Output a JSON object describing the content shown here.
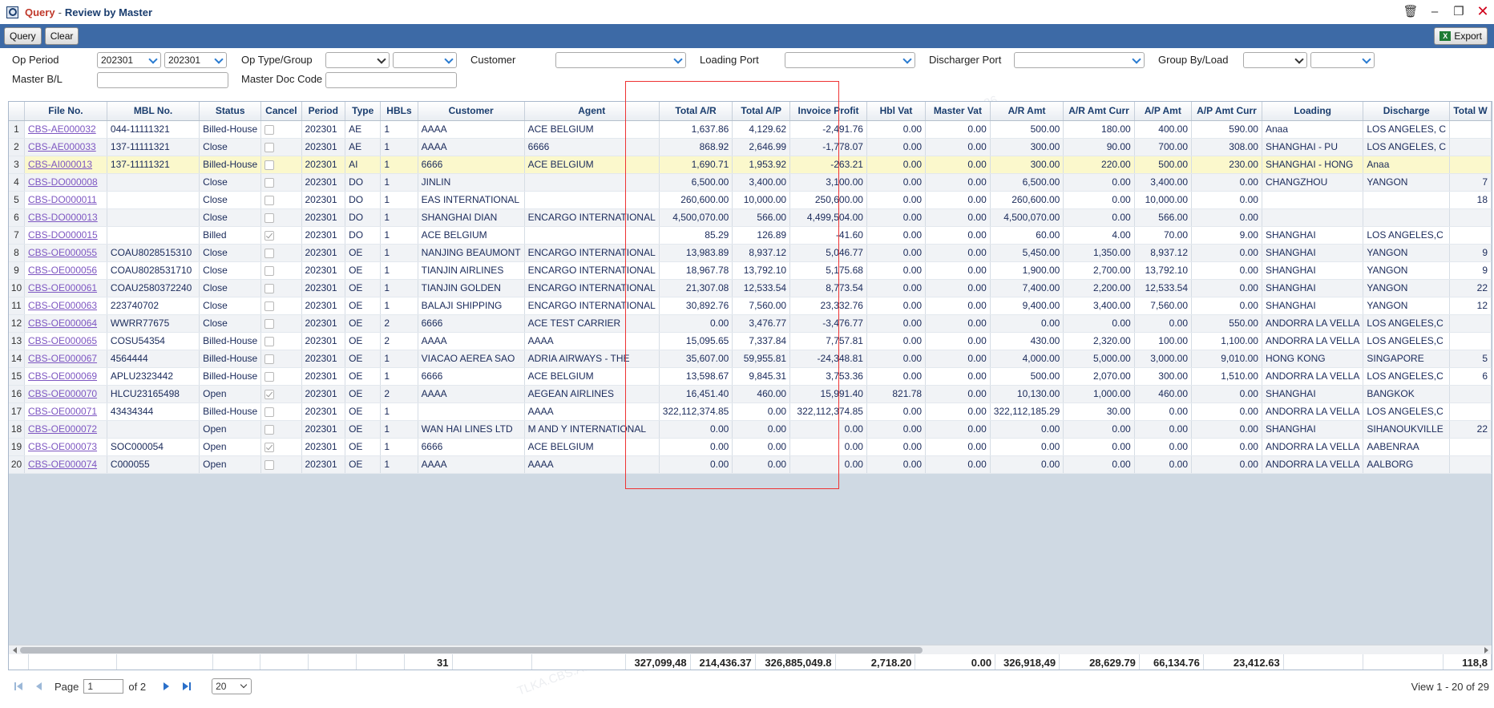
{
  "window": {
    "title_app": "Query",
    "title_sep": "-",
    "title_view": "Review by Master"
  },
  "toolbar": {
    "query_label": "Query",
    "clear_label": "Clear",
    "export_label": "Export"
  },
  "filters": {
    "op_period_label": "Op Period",
    "op_period_from": "202301",
    "op_period_to": "202301",
    "op_type_label": "Op Type/Group",
    "customer_label": "Customer",
    "loading_port_label": "Loading Port",
    "discharger_port_label": "Discharger Port",
    "group_by_label": "Group By/Load",
    "master_bl_label": "Master B/L",
    "master_doc_label": "Master Doc Code"
  },
  "columns": [
    "File No.",
    "MBL No.",
    "Status",
    "Cancel",
    "Period",
    "Type",
    "HBLs",
    "Customer",
    "Agent",
    "Total A/R",
    "Total A/P",
    "Invoice Profit",
    "Hbl Vat",
    "Master Vat",
    "A/R Amt",
    "A/R Amt Curr",
    "A/P Amt",
    "A/P Amt Curr",
    "Loading",
    "Discharge",
    "Total W"
  ],
  "rows": [
    [
      "1",
      "CBS-AE000032",
      "044-11111321",
      "Billed-House",
      "off",
      "202301",
      "AE",
      "1",
      "AAAA",
      "ACE BELGIUM",
      "1,637.86",
      "4,129.62",
      "-2,491.76",
      "0.00",
      "0.00",
      "500.00",
      "180.00",
      "400.00",
      "590.00",
      "Anaa",
      "LOS ANGELES, C",
      ""
    ],
    [
      "2",
      "CBS-AE000033",
      "137-11111321",
      "Close",
      "off",
      "202301",
      "AE",
      "1",
      "AAAA",
      "6666",
      "868.92",
      "2,646.99",
      "-1,778.07",
      "0.00",
      "0.00",
      "300.00",
      "90.00",
      "700.00",
      "308.00",
      "SHANGHAI - PU",
      "LOS ANGELES, C",
      ""
    ],
    [
      "3",
      "CBS-AI000013",
      "137-11111321",
      "Billed-House",
      "off",
      "202301",
      "AI",
      "1",
      "6666",
      "ACE BELGIUM",
      "1,690.71",
      "1,953.92",
      "-263.21",
      "0.00",
      "0.00",
      "300.00",
      "220.00",
      "500.00",
      "230.00",
      "SHANGHAI - HONG",
      "Anaa",
      ""
    ],
    [
      "4",
      "CBS-DO000008",
      "",
      "Close",
      "off",
      "202301",
      "DO",
      "1",
      "JINLIN",
      "",
      "6,500.00",
      "3,400.00",
      "3,100.00",
      "0.00",
      "0.00",
      "6,500.00",
      "0.00",
      "3,400.00",
      "0.00",
      "CHANGZHOU",
      "YANGON",
      "7"
    ],
    [
      "5",
      "CBS-DO000011",
      "",
      "Close",
      "off",
      "202301",
      "DO",
      "1",
      "EAS INTERNATIONAL",
      "",
      "260,600.00",
      "10,000.00",
      "250,600.00",
      "0.00",
      "0.00",
      "260,600.00",
      "0.00",
      "10,000.00",
      "0.00",
      "",
      "",
      "18"
    ],
    [
      "6",
      "CBS-DO000013",
      "",
      "Close",
      "off",
      "202301",
      "DO",
      "1",
      "SHANGHAI DIAN",
      "ENCARGO INTERNATIONAL",
      "4,500,070.00",
      "566.00",
      "4,499,504.00",
      "0.00",
      "0.00",
      "4,500,070.00",
      "0.00",
      "566.00",
      "0.00",
      "",
      "",
      ""
    ],
    [
      "7",
      "CBS-DO000015",
      "",
      "Billed",
      "on",
      "202301",
      "DO",
      "1",
      "ACE BELGIUM",
      "",
      "85.29",
      "126.89",
      "-41.60",
      "0.00",
      "0.00",
      "60.00",
      "4.00",
      "70.00",
      "9.00",
      "SHANGHAI",
      "LOS ANGELES,C",
      ""
    ],
    [
      "8",
      "CBS-OE000055",
      "COAU8028515310",
      "Close",
      "off",
      "202301",
      "OE",
      "1",
      "NANJING BEAUMONT",
      "ENCARGO INTERNATIONAL",
      "13,983.89",
      "8,937.12",
      "5,046.77",
      "0.00",
      "0.00",
      "5,450.00",
      "1,350.00",
      "8,937.12",
      "0.00",
      "SHANGHAI",
      "YANGON",
      "9"
    ],
    [
      "9",
      "CBS-OE000056",
      "COAU8028531710",
      "Close",
      "off",
      "202301",
      "OE",
      "1",
      "TIANJIN AIRLINES",
      "ENCARGO INTERNATIONAL",
      "18,967.78",
      "13,792.10",
      "5,175.68",
      "0.00",
      "0.00",
      "1,900.00",
      "2,700.00",
      "13,792.10",
      "0.00",
      "SHANGHAI",
      "YANGON",
      "9"
    ],
    [
      "10",
      "CBS-OE000061",
      "COAU2580372240",
      "Close",
      "off",
      "202301",
      "OE",
      "1",
      "TIANJIN GOLDEN",
      "ENCARGO INTERNATIONAL",
      "21,307.08",
      "12,533.54",
      "8,773.54",
      "0.00",
      "0.00",
      "7,400.00",
      "2,200.00",
      "12,533.54",
      "0.00",
      "SHANGHAI",
      "YANGON",
      "22"
    ],
    [
      "11",
      "CBS-OE000063",
      "223740702",
      "Close",
      "off",
      "202301",
      "OE",
      "1",
      "BALAJI SHIPPING",
      "ENCARGO INTERNATIONAL",
      "30,892.76",
      "7,560.00",
      "23,332.76",
      "0.00",
      "0.00",
      "9,400.00",
      "3,400.00",
      "7,560.00",
      "0.00",
      "SHANGHAI",
      "YANGON",
      "12"
    ],
    [
      "12",
      "CBS-OE000064",
      "WWRR77675",
      "Close",
      "off",
      "202301",
      "OE",
      "2",
      "6666",
      "ACE TEST CARRIER",
      "0.00",
      "3,476.77",
      "-3,476.77",
      "0.00",
      "0.00",
      "0.00",
      "0.00",
      "0.00",
      "550.00",
      "ANDORRA LA VELLA",
      "LOS ANGELES,C",
      ""
    ],
    [
      "13",
      "CBS-OE000065",
      "COSU54354",
      "Billed-House",
      "off",
      "202301",
      "OE",
      "2",
      "AAAA",
      "AAAA",
      "15,095.65",
      "7,337.84",
      "7,757.81",
      "0.00",
      "0.00",
      "430.00",
      "2,320.00",
      "100.00",
      "1,100.00",
      "ANDORRA LA VELLA",
      "LOS ANGELES,C",
      ""
    ],
    [
      "14",
      "CBS-OE000067",
      "4564444",
      "Billed-House",
      "off",
      "202301",
      "OE",
      "1",
      "VIACAO AEREA SAO",
      "ADRIA AIRWAYS - THE",
      "35,607.00",
      "59,955.81",
      "-24,348.81",
      "0.00",
      "0.00",
      "4,000.00",
      "5,000.00",
      "3,000.00",
      "9,010.00",
      "HONG KONG",
      "SINGAPORE",
      "5"
    ],
    [
      "15",
      "CBS-OE000069",
      "APLU2323442",
      "Billed-House",
      "off",
      "202301",
      "OE",
      "1",
      "6666",
      "ACE BELGIUM",
      "13,598.67",
      "9,845.31",
      "3,753.36",
      "0.00",
      "0.00",
      "500.00",
      "2,070.00",
      "300.00",
      "1,510.00",
      "ANDORRA LA VELLA",
      "LOS ANGELES,C",
      "6"
    ],
    [
      "16",
      "CBS-OE000070",
      "HLCU23165498",
      "Open",
      "on",
      "202301",
      "OE",
      "2",
      "AAAA",
      "AEGEAN AIRLINES",
      "16,451.40",
      "460.00",
      "15,991.40",
      "821.78",
      "0.00",
      "10,130.00",
      "1,000.00",
      "460.00",
      "0.00",
      "SHANGHAI",
      "BANGKOK",
      ""
    ],
    [
      "17",
      "CBS-OE000071",
      "43434344",
      "Billed-House",
      "off",
      "202301",
      "OE",
      "1",
      "",
      "AAAA",
      "322,112,374.85",
      "0.00",
      "322,112,374.85",
      "0.00",
      "0.00",
      "322,112,185.29",
      "30.00",
      "0.00",
      "0.00",
      "ANDORRA LA VELLA",
      "LOS ANGELES,C",
      ""
    ],
    [
      "18",
      "CBS-OE000072",
      "",
      "Open",
      "off",
      "202301",
      "OE",
      "1",
      "WAN HAI LINES LTD",
      "M AND Y INTERNATIONAL",
      "0.00",
      "0.00",
      "0.00",
      "0.00",
      "0.00",
      "0.00",
      "0.00",
      "0.00",
      "0.00",
      "SHANGHAI",
      "SIHANOUKVILLE",
      "22"
    ],
    [
      "19",
      "CBS-OE000073",
      "SOC000054",
      "Open",
      "on",
      "202301",
      "OE",
      "1",
      "6666",
      "ACE BELGIUM",
      "0.00",
      "0.00",
      "0.00",
      "0.00",
      "0.00",
      "0.00",
      "0.00",
      "0.00",
      "0.00",
      "ANDORRA LA VELLA",
      "AABENRAA",
      ""
    ],
    [
      "20",
      "CBS-OE000074",
      "C000055",
      "Open",
      "off",
      "202301",
      "OE",
      "1",
      "AAAA",
      "AAAA",
      "0.00",
      "0.00",
      "0.00",
      "0.00",
      "0.00",
      "0.00",
      "0.00",
      "0.00",
      "0.00",
      "ANDORRA LA VELLA",
      "AALBORG",
      ""
    ]
  ],
  "totals": [
    "",
    "",
    "",
    "",
    "",
    "",
    "",
    "31",
    "",
    "",
    "327,099,48",
    "214,436.37",
    "326,885,049.8",
    "2,718.20",
    "0.00",
    "326,918,49",
    "28,629.79",
    "66,134.76",
    "23,412.63",
    "",
    "",
    "118,8"
  ],
  "pager": {
    "page_label": "Page",
    "page_value": "1",
    "of_label": "of 2",
    "rows_per_page": "20",
    "view_text": "View 1 - 20 of 29"
  },
  "watermark_text": "TLKA.CBS.Admin 2024-02-26",
  "colors": {
    "toolbar_bg": "#3d6aa6",
    "link": "#7e57c2",
    "highlight": "#e33333"
  }
}
